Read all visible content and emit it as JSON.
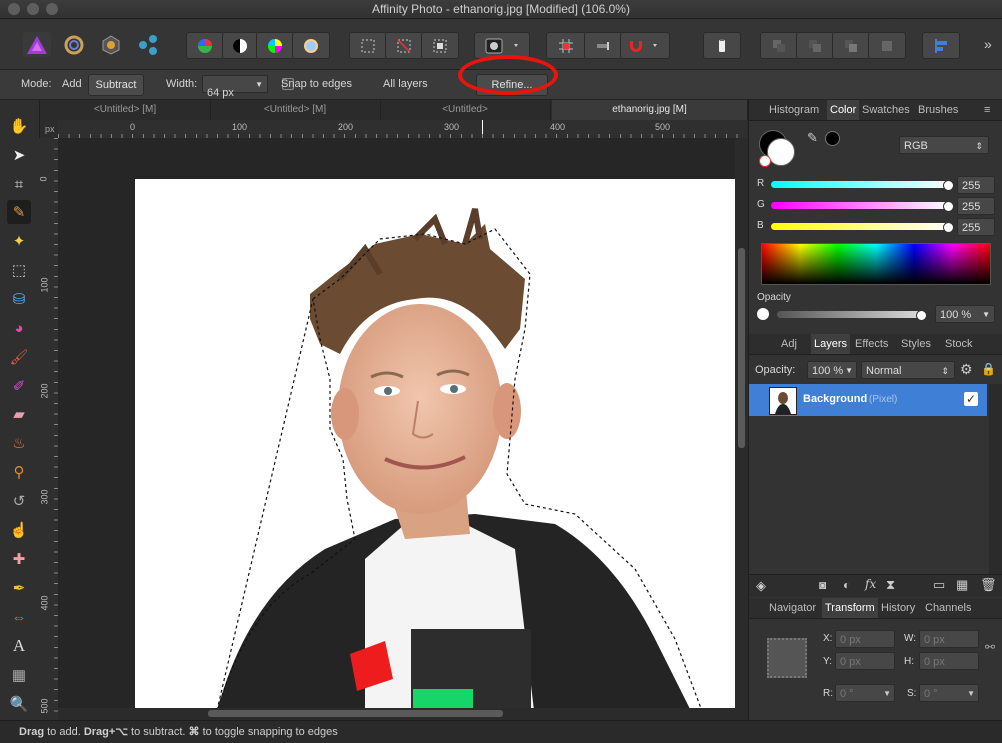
{
  "window": {
    "title": "Affinity Photo - ethanorig.jpg [Modified] (106.0%)"
  },
  "context_toolbar": {
    "mode_label": "Mode:",
    "add_label": "Add",
    "subtract_label": "Subtract",
    "width_label": "Width:",
    "width_value": "64 px",
    "snap_label": "Snap to edges",
    "all_layers_label": "All layers",
    "refine_label": "Refine..."
  },
  "document_tabs": [
    {
      "label": "<Untitled> [M]"
    },
    {
      "label": "<Untitled> [M]"
    },
    {
      "label": "<Untitled>"
    },
    {
      "label": "ethanorig.jpg [M]"
    }
  ],
  "ruler": {
    "unit": "px",
    "h_ticks": [
      "0",
      "100",
      "200",
      "300",
      "400",
      "500"
    ],
    "v_ticks": [
      "0",
      "100",
      "200",
      "300",
      "400",
      "500"
    ]
  },
  "color_panel": {
    "tabs": [
      "Histogram",
      "Color",
      "Swatches",
      "Brushes"
    ],
    "model": "RGB",
    "r_label": "R",
    "r_value": "255",
    "g_label": "G",
    "g_value": "255",
    "b_label": "B",
    "b_value": "255",
    "opacity_label": "Opacity",
    "opacity_value": "100 %"
  },
  "layers_panel": {
    "tabs": [
      "Adj",
      "Layers",
      "Effects",
      "Styles",
      "Stock"
    ],
    "opacity_label": "Opacity:",
    "opacity_value": "100 %",
    "blend_mode": "Normal",
    "layer_name": "Background",
    "layer_type": "(Pixel)"
  },
  "transform_panel": {
    "tabs": [
      "Navigator",
      "Transform",
      "History",
      "Channels"
    ],
    "x_label": "X:",
    "x_value": "0 px",
    "y_label": "Y:",
    "y_value": "0 px",
    "w_label": "W:",
    "w_value": "0 px",
    "h_label": "H:",
    "h_value": "0 px",
    "r_label": "R:",
    "r_value": "0 °",
    "s_label": "S:",
    "s_value": "0 °"
  },
  "status": {
    "drag": "Drag",
    "t1": " to add. ",
    "drag_alt": "Drag+⌥",
    "t2": " to subtract. ",
    "cmd": "⌘",
    "t3": " to toggle snapping to edges"
  },
  "colors": {
    "accent": "#3f7fd6",
    "highlight": "#e8150d"
  }
}
